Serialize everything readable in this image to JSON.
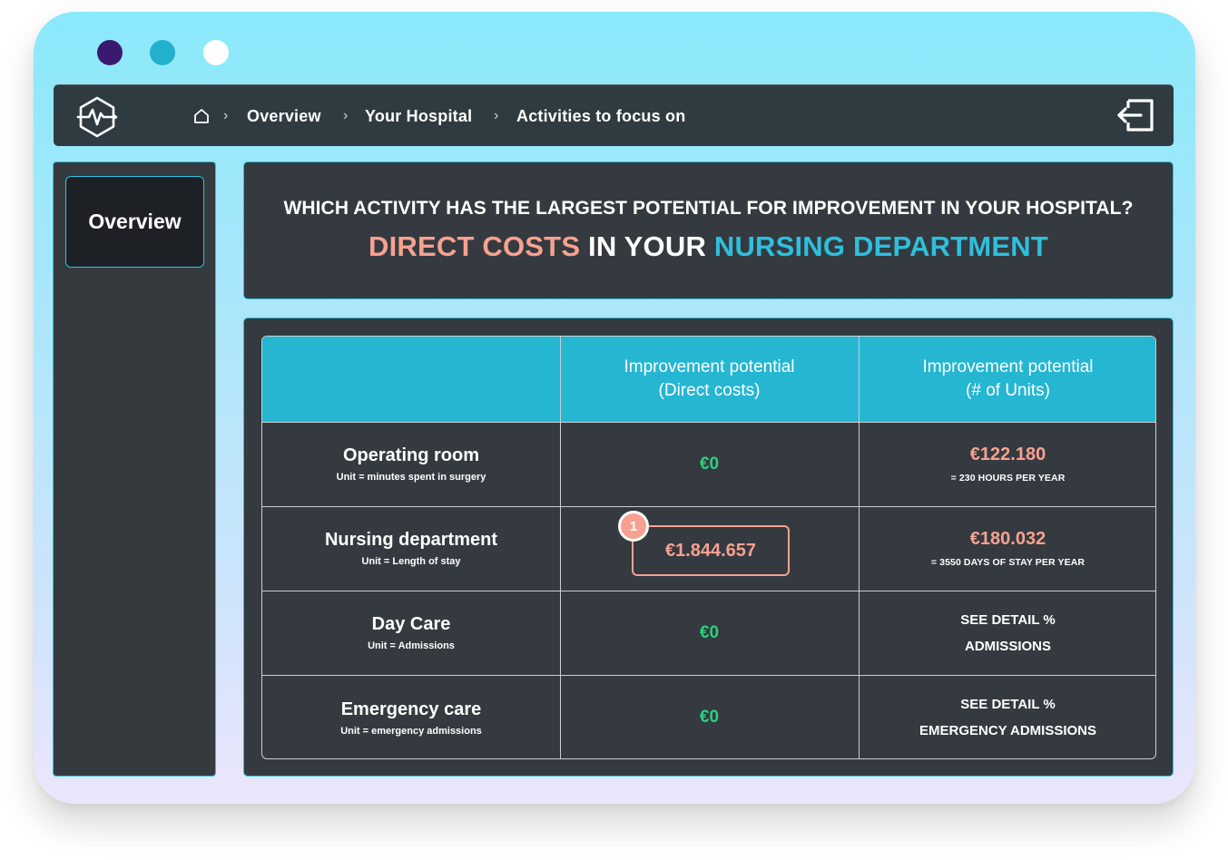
{
  "breadcrumb": {
    "items": [
      {
        "label": "Overview"
      },
      {
        "label": "Your Hospital"
      },
      {
        "label": "Activities to focus on"
      }
    ],
    "separator": "›"
  },
  "sidebar": {
    "items": [
      {
        "label": "Overview"
      }
    ]
  },
  "headline": {
    "question": "WHICH ACTIVITY HAS THE LARGEST POTENTIAL FOR IMPROVEMENT IN YOUR HOSPITAL?",
    "sub_part1": "DIRECT COSTS",
    "sub_part2": " IN YOUR ",
    "sub_part3": "NURSING DEPARTMENT"
  },
  "table": {
    "columns": [
      {
        "line1": "",
        "line2": ""
      },
      {
        "line1": "Improvement potential",
        "line2": "(Direct costs)"
      },
      {
        "line1": "Improvement potential",
        "line2": "(# of Units)"
      }
    ],
    "rows": [
      {
        "name": "Operating room",
        "unit": "Unit = minutes spent in surgery",
        "direct": "€0",
        "units_value": "€122.180",
        "units_sub": "= 230 HOURS PER YEAR"
      },
      {
        "name": "Nursing department",
        "unit": "Unit = Length of stay",
        "direct": "€1.844.657",
        "units_value": "€180.032",
        "units_sub": "= 3550 DAYS OF STAY PER YEAR"
      },
      {
        "name": "Day Care",
        "unit": "Unit = Admissions",
        "direct": "€0",
        "see_line1": "SEE DETAIL %",
        "see_line2": "ADMISSIONS"
      },
      {
        "name": "Emergency care",
        "unit": "Unit = emergency admissions",
        "direct": "€0",
        "see_line1": "SEE DETAIL %",
        "see_line2": "EMERGENCY ADMISSIONS"
      }
    ]
  },
  "badge": {
    "number": "1"
  },
  "colors": {
    "accent_cyan": "#25b6d2",
    "highlight_salmon": "#f7a191",
    "value_green": "#2ad07f",
    "panel_dark": "#343a3f"
  },
  "icons": {
    "logo": "heartbeat-hexagon-icon",
    "home": "home-icon",
    "exit": "logout-icon"
  }
}
